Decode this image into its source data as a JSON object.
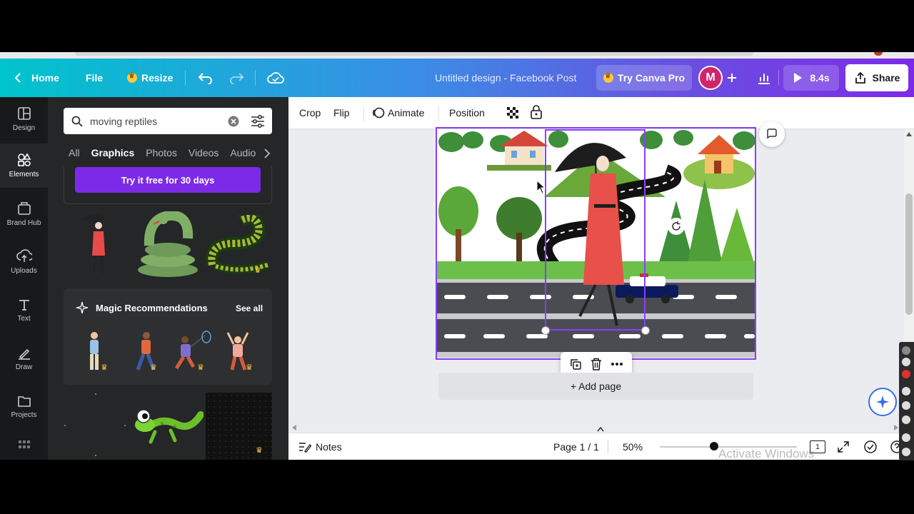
{
  "topbar": {
    "home_label": "Home",
    "file_label": "File",
    "resize_label": "Resize",
    "design_title": "Untitled design - Facebook Post",
    "pro_label": "Try Canva Pro",
    "avatar_initial": "M",
    "play_label": "8.4s",
    "share_label": "Share"
  },
  "rail": [
    {
      "label": "Design",
      "icon": "design-icon"
    },
    {
      "label": "Elements",
      "icon": "elements-icon"
    },
    {
      "label": "Brand Hub",
      "icon": "brand-hub-icon"
    },
    {
      "label": "Uploads",
      "icon": "uploads-icon"
    },
    {
      "label": "Text",
      "icon": "text-icon"
    },
    {
      "label": "Draw",
      "icon": "draw-icon"
    },
    {
      "label": "Projects",
      "icon": "projects-icon"
    }
  ],
  "panel": {
    "search_value": "moving reptiles",
    "tabs": [
      "All",
      "Graphics",
      "Photos",
      "Videos",
      "Audio"
    ],
    "active_tab": "Graphics",
    "trial_label": "Try it free for 30 days",
    "magic_title": "Magic Recommendations",
    "magic_see_all": "See all"
  },
  "context_toolbar": {
    "crop": "Crop",
    "flip": "Flip",
    "animate": "Animate",
    "position": "Position"
  },
  "canvas": {
    "add_page_label": "+ Add page"
  },
  "bottombar": {
    "notes_label": "Notes",
    "page_label": "Page 1 / 1",
    "zoom_label": "50%",
    "page_count_badge": "1"
  },
  "overlay": {
    "watermark_text": "Activate Windows"
  },
  "colors": {
    "accent": "#8b3dff",
    "brand_teal": "#00c4cc",
    "brand_purple": "#7d2ae8",
    "panel_bg": "#252627",
    "rail_bg": "#18191b"
  }
}
